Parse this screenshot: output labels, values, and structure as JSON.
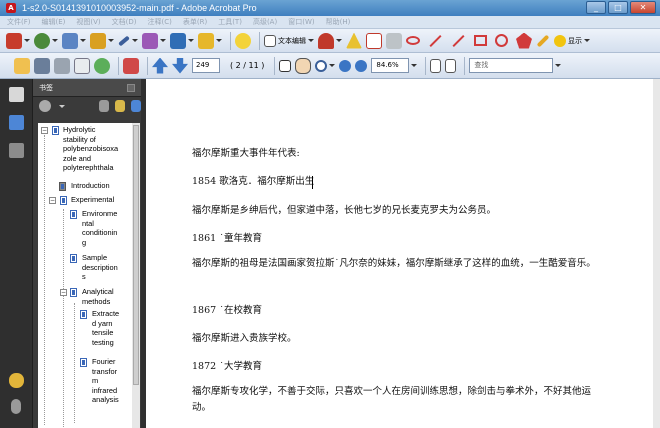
{
  "window": {
    "title": "1-s2.0-S0141391010003952-main.pdf - Adobe Acrobat Pro",
    "app_letter": "A",
    "min": "_",
    "max": "□",
    "close": "✕"
  },
  "menu": [
    "文件(F)",
    "编辑(E)",
    "视图(V)",
    "文档(D)",
    "注释(C)",
    "表单(R)",
    "工具(T)",
    "高级(A)",
    "窗口(W)",
    "帮助(H)"
  ],
  "toolbar1": {
    "text_edit_label": "文本编辑",
    "show_label": "显示"
  },
  "toolbar2": {
    "page_number": "249",
    "page_count": "( 2 / 11 )",
    "zoom": "84.6%",
    "search_placeholder": "查找"
  },
  "bookmarks": {
    "title": "书签",
    "items": [
      {
        "label": "Hydrolytic stability of polybenzobisoxazole and polyterephthala",
        "lines": [
          "Hydrolytic",
          "stability of",
          "polybenzobisoxa",
          "zole and",
          "polyterephthala"
        ]
      },
      {
        "label": "Introduction"
      },
      {
        "label": "Experimental"
      },
      {
        "label": "Environmental conditioning",
        "lines": [
          "Environme",
          "ntal",
          "conditionin",
          "g"
        ]
      },
      {
        "label": "Sample descriptions",
        "lines": [
          "Sample",
          "description",
          "s"
        ]
      },
      {
        "label": "Analytical methods",
        "lines": [
          "Analytical",
          "methods"
        ]
      },
      {
        "label": "Extracted yarn tensile testing",
        "lines": [
          "Extracte",
          "d yarn",
          "tensile",
          "testing"
        ]
      },
      {
        "label": "Fourier transform infrared analysis",
        "lines": [
          "Fourier",
          "transfor",
          "m",
          "infrared",
          "analysis"
        ]
      }
    ]
  },
  "document": {
    "paragraphs": [
      "福尔摩斯重大事件年代表:",
      "1854 歌洛克．福尔摩斯出生",
      "福尔摩斯是乡绅后代，但家道中落，长他七岁的兄长麦克罗夫为公务员。",
      "1861 ˙童年教育",
      "福尔摩斯的祖母是法国画家贺拉斯˙凡尔奈的妹妹，福尔摩斯继承了这样的血统，一生酷爱音乐。",
      "1867 ˙在校教育",
      "福尔摩斯进入贵族学校。",
      "1872 ˙大学教育",
      "福尔摩斯专攻化学，不善于交际，只喜欢一个人在房间训练思想，除剑击与拳术外，不好其他运动。"
    ]
  }
}
